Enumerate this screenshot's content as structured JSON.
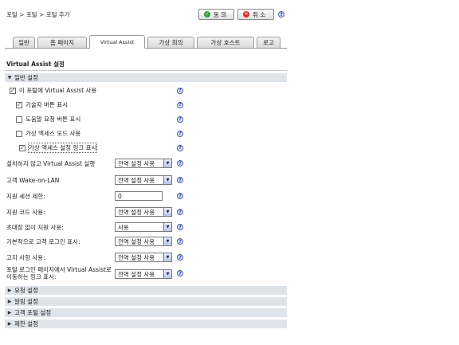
{
  "breadcrumb": "포털 > 포털 > 포털 추가",
  "buttons": {
    "ok": "동 의",
    "cancel": "취 소"
  },
  "tabs": [
    {
      "label": "일반"
    },
    {
      "label": "홈 페이지"
    },
    {
      "label": "Virtual Assist"
    },
    {
      "label": "가상 회의"
    },
    {
      "label": "가상 호스트"
    },
    {
      "label": "로고"
    }
  ],
  "section_title": "Virtual Assist 설정",
  "groups": {
    "general": "일반 설정",
    "request": "요청 설정",
    "notify": "알림 설정",
    "customer_portal": "고객 포털 설정",
    "restrict": "제한 설정"
  },
  "checkboxes": [
    {
      "label": "이 포털에 Virtual Assist 사용",
      "checked": true
    },
    {
      "label": "기술자 버튼 표시",
      "checked": true
    },
    {
      "label": "도움말 요청 버튼 표시",
      "checked": false
    },
    {
      "label": "가상 액세스 모드 사용",
      "checked": false
    },
    {
      "label": "가상 액세스 설정 링크 표시",
      "checked": true
    }
  ],
  "check_mark": "✓",
  "fields": [
    {
      "label": "설치하지 않고 Virtual Assist 실행",
      "type": "select",
      "value": "전역 설정 사용"
    },
    {
      "label": "고객 Wake-on-LAN",
      "type": "select",
      "value": "전역 설정 사용"
    },
    {
      "label": "지원 세션 제한:",
      "type": "text",
      "value": "0"
    },
    {
      "label": "지원 코드 사용:",
      "type": "select",
      "value": "전역 설정 사용"
    },
    {
      "label": "초대장 없이 지원 사용:",
      "type": "select",
      "value": "사용"
    },
    {
      "label": "기본적으로 고객 로그인 표시:",
      "type": "select",
      "value": "전역 설정 사용"
    },
    {
      "label": "고지 사항 사용:",
      "type": "select",
      "value": "전역 설정 사용"
    },
    {
      "label": "포털 로그인 페이지에서 Virtual Assist로 이동하는 링크 표시:",
      "type": "select",
      "value": "전역 설정 사용"
    }
  ],
  "icons": {
    "help": "?",
    "ok": "✓",
    "cancel": "✕",
    "expanded": "▼",
    "collapsed": "▶",
    "dropdown": "▼"
  }
}
